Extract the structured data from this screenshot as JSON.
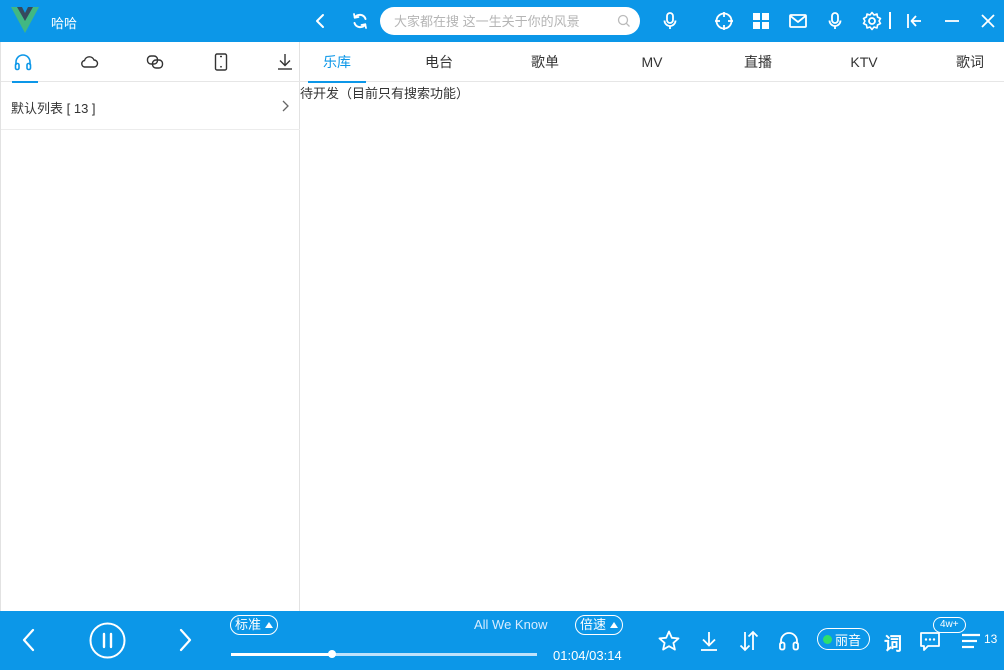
{
  "colors": {
    "brand": "#0c97e8",
    "accent_green": "#2ee06b",
    "logo_green": "#41b883",
    "logo_dark": "#35495e"
  },
  "titlebar": {
    "app_title": "哈哈",
    "search_placeholder": "大家都在搜 这一生关于你的风景",
    "icons": [
      "back-icon",
      "refresh-icon",
      "voice-icon",
      "crosshair-icon",
      "grid-icon",
      "mail-icon",
      "mic-icon",
      "settings-icon",
      "collapse-icon",
      "minimize-icon",
      "close-icon"
    ]
  },
  "left_panel": {
    "tabs": [
      "headphones-icon",
      "cloud-icon",
      "link-icon",
      "tablet-icon",
      "download-icon"
    ],
    "active_tab": 0,
    "playlist": {
      "label": "默认列表 [ 13 ]"
    }
  },
  "main": {
    "tabs": [
      {
        "label": "乐库",
        "active": true
      },
      {
        "label": "电台",
        "active": false
      },
      {
        "label": "歌单",
        "active": false
      },
      {
        "label": "MV",
        "active": false
      },
      {
        "label": "直播",
        "active": false
      },
      {
        "label": "KTV",
        "active": false
      },
      {
        "label": "歌词",
        "active": false
      }
    ],
    "content_text": "待开发（目前只有搜索功能）"
  },
  "player": {
    "quality_label": "标准",
    "song_title": "All We Know",
    "speed_label": "倍速",
    "time": "01:04/03:14",
    "progress_fraction": 0.33,
    "liyin_label": "丽音",
    "lyrics_label": "词",
    "comment_badge": "4w+",
    "queue_count": "13"
  }
}
